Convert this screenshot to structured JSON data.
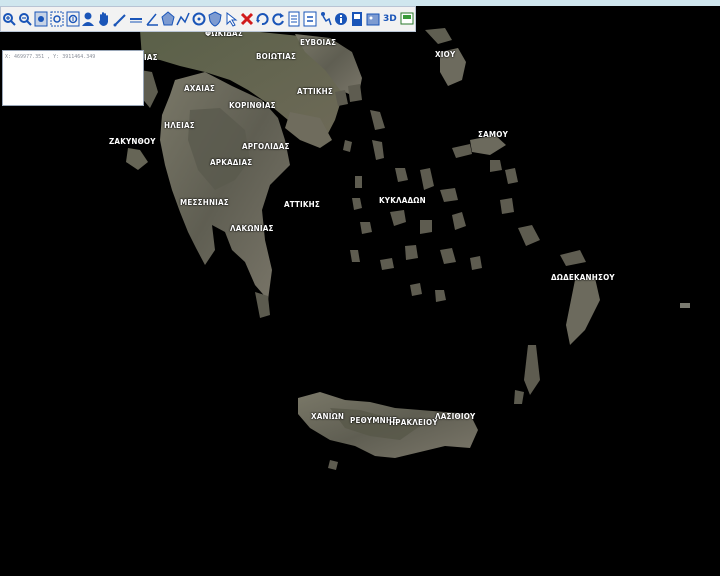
{
  "toolbar": {
    "items": [
      {
        "icon": "zoom-in-icon"
      },
      {
        "icon": "zoom-out-icon"
      },
      {
        "icon": "full-extent-icon"
      },
      {
        "icon": "zoom-box-icon"
      },
      {
        "icon": "zoom-layer-icon"
      },
      {
        "icon": "user-icon"
      },
      {
        "icon": "hand-pan-icon"
      },
      {
        "icon": "measure-line-icon"
      },
      {
        "icon": "ruler-icon"
      },
      {
        "icon": "measure-angle-icon"
      },
      {
        "icon": "polygon-icon"
      },
      {
        "icon": "polyline-icon"
      },
      {
        "icon": "circle-target-icon"
      },
      {
        "icon": "shield-icon"
      },
      {
        "icon": "select-pointer-icon"
      },
      {
        "icon": "delete-x-icon"
      },
      {
        "icon": "rotate-icon"
      },
      {
        "icon": "refresh-icon"
      },
      {
        "icon": "document-icon"
      },
      {
        "icon": "coordinates-xy-icon"
      },
      {
        "icon": "route-icon"
      },
      {
        "icon": "info-icon"
      },
      {
        "icon": "bookmark-icon"
      },
      {
        "icon": "gallery-icon"
      },
      {
        "icon": "three-d-icon"
      },
      {
        "icon": "screen-icon"
      }
    ],
    "three_d_label": "3D"
  },
  "coordinates": {
    "text": "X: 469977.351 , Y: 3911464.349"
  },
  "map_labels": [
    {
      "name": "prefecture-label-fokidas",
      "text": "ΦΩΚΙΔΑΣ"
    },
    {
      "name": "prefecture-label-evvoias",
      "text": "ΕΥΒΟΙΑΣ"
    },
    {
      "name": "prefecture-label-viotias",
      "text": "ΒΟΙΩΤΙΑΣ"
    },
    {
      "name": "prefecture-label-hiou",
      "text": "ΧΙΟΥ"
    },
    {
      "name": "prefecture-label-ias",
      "text": "ΙΑΣ"
    },
    {
      "name": "prefecture-label-ahaias",
      "text": "ΑΧΑΙΑΣ"
    },
    {
      "name": "prefecture-label-attikis-north",
      "text": "ΑΤΤΙΚΗΣ"
    },
    {
      "name": "prefecture-label-korinthias",
      "text": "ΚΟΡΙΝΘΙΑΣ"
    },
    {
      "name": "prefecture-label-ilias",
      "text": "ΗΛΕΙΑΣ"
    },
    {
      "name": "prefecture-label-samou",
      "text": "ΣΑΜΟΥ"
    },
    {
      "name": "prefecture-label-zakynthou",
      "text": "ΖΑΚΥΝΘΟΥ"
    },
    {
      "name": "prefecture-label-argolidas",
      "text": "ΑΡΓΟΛΙΔΑΣ"
    },
    {
      "name": "prefecture-label-arkadias",
      "text": "ΑΡΚΑΔΙΑΣ"
    },
    {
      "name": "prefecture-label-messinias",
      "text": "ΜΕΣΣΗΝΙΑΣ"
    },
    {
      "name": "prefecture-label-attikis-south",
      "text": "ΑΤΤΙΚΗΣ"
    },
    {
      "name": "prefecture-label-kykladon",
      "text": "ΚΥΚΛΑΔΩΝ"
    },
    {
      "name": "prefecture-label-lakonias",
      "text": "ΛΑΚΩΝΙΑΣ"
    },
    {
      "name": "prefecture-label-dodekanisou",
      "text": "ΔΩΔΕΚΑΝΗΣΟΥ"
    },
    {
      "name": "prefecture-label-hanion",
      "text": "ΧΑΝΙΩΝ"
    },
    {
      "name": "prefecture-label-rethymnis",
      "text": "ΡΕΘΥΜΝΗΣ"
    },
    {
      "name": "prefecture-label-irakleiou",
      "text": "ΗΡΑΚΛΕΙΟΥ"
    },
    {
      "name": "prefecture-label-lasithiou",
      "text": "ΛΑΣΙΘΙΟΥ"
    }
  ],
  "colors": {
    "sea": "#000000",
    "land": "#6b6a5e",
    "toolbar_bg": "#f2f2f2",
    "icon_blue": "#1a55b8"
  }
}
